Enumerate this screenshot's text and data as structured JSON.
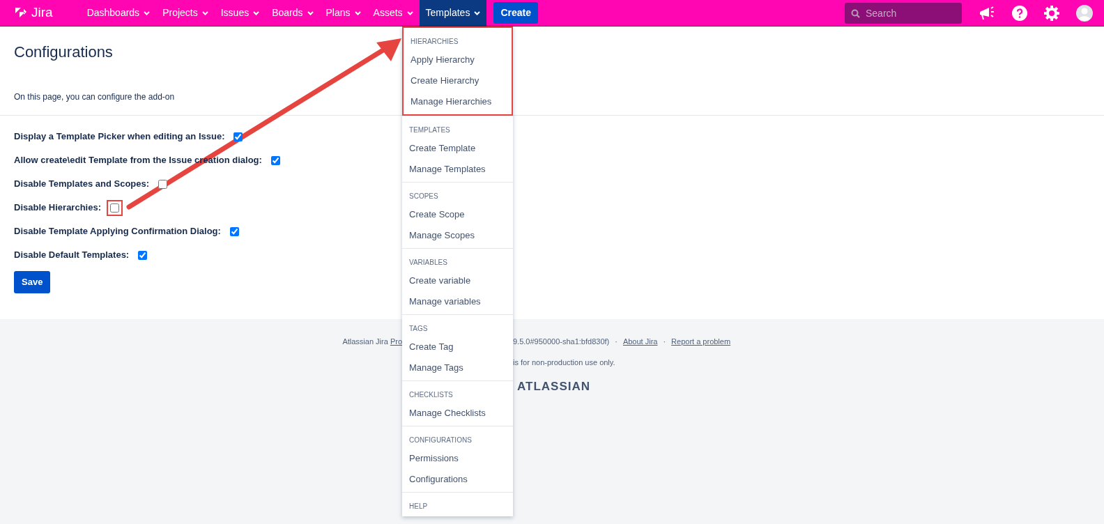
{
  "navbar": {
    "logo": "Jira",
    "menus": [
      {
        "label": "Dashboards",
        "selected": false
      },
      {
        "label": "Projects",
        "selected": false
      },
      {
        "label": "Issues",
        "selected": false
      },
      {
        "label": "Boards",
        "selected": false
      },
      {
        "label": "Plans",
        "selected": false
      },
      {
        "label": "Assets",
        "selected": false
      },
      {
        "label": "Templates",
        "selected": true
      }
    ],
    "create_button": "Create",
    "search": {
      "placeholder": "Search"
    }
  },
  "page": {
    "title": "Configurations",
    "description": "On this page, you can configure the add-on",
    "settings": [
      {
        "label": "Display a Template Picker when editing an Issue:",
        "checked": true,
        "highlighted": false
      },
      {
        "label": "Allow create\\edit Template from the Issue creation dialog:",
        "checked": true,
        "highlighted": false
      },
      {
        "label": "Disable Templates and Scopes:",
        "checked": false,
        "highlighted": false
      },
      {
        "label": "Disable Hierarchies:",
        "checked": false,
        "highlighted": true
      },
      {
        "label": "Disable Template Applying Confirmation Dialog:",
        "checked": true,
        "highlighted": false
      },
      {
        "label": "Disable Default Templates:",
        "checked": true,
        "highlighted": false
      }
    ],
    "save_button": "Save"
  },
  "footer": {
    "line1_left": "Atlassian Jira",
    "line1_link": "Pro",
    "line1_right": "9.5.0#950000-sha1:bfd830f)",
    "separator": "·",
    "links": [
      "About Jira",
      "Report a problem"
    ],
    "line2": "is for non-production use only.",
    "brand": "ATLASSIAN"
  },
  "dropdown": {
    "sections": [
      {
        "header": "HIERARCHIES",
        "highlighted": true,
        "items": [
          "Apply Hierarchy",
          "Create Hierarchy",
          "Manage Hierarchies"
        ]
      },
      {
        "header": "TEMPLATES",
        "highlighted": false,
        "items": [
          "Create Template",
          "Manage Templates"
        ]
      },
      {
        "header": "SCOPES",
        "highlighted": false,
        "items": [
          "Create Scope",
          "Manage Scopes"
        ]
      },
      {
        "header": "VARIABLES",
        "highlighted": false,
        "items": [
          "Create variable",
          "Manage variables"
        ]
      },
      {
        "header": "TAGS",
        "highlighted": false,
        "items": [
          "Create Tag",
          "Manage Tags"
        ]
      },
      {
        "header": "CHECKLISTS",
        "highlighted": false,
        "items": [
          "Manage Checklists"
        ]
      },
      {
        "header": "CONFIGURATIONS",
        "highlighted": false,
        "items": [
          "Permissions",
          "Configurations"
        ]
      },
      {
        "header": "HELP",
        "highlighted": false
      }
    ]
  }
}
